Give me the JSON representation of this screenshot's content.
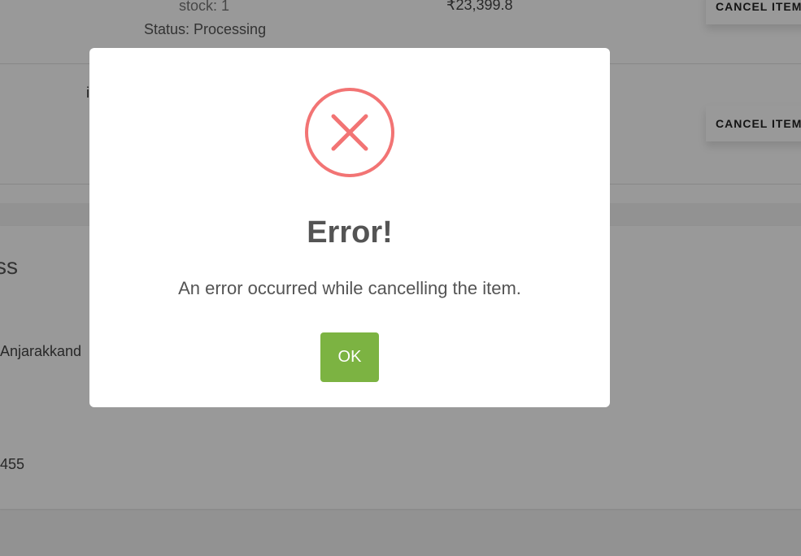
{
  "orders": {
    "row1": {
      "stock_text": "stock: 1",
      "status_text": "Status: Processing",
      "price": "₹23,399.8",
      "cancel_label": "CANCEL ITEM"
    },
    "row2": {
      "name_fragment": "i",
      "cancel_label": "CANCEL ITEM"
    }
  },
  "address": {
    "title_fragment": "ss",
    "line_fragment": "Anjarakkand",
    "phone_fragment": "455"
  },
  "dialog": {
    "icon": "error-x-icon",
    "title": "Error!",
    "message": "An error occurred while cancelling the item.",
    "ok_label": "OK",
    "colors": {
      "icon": "#f27474",
      "ok_button": "#7cb342"
    }
  }
}
